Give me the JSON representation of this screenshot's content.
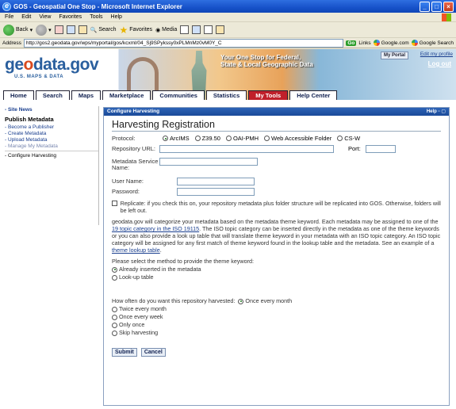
{
  "window": {
    "title": "GOS - Geospatial One Stop - Microsoft Internet Explorer"
  },
  "menu": [
    "File",
    "Edit",
    "View",
    "Favorites",
    "Tools",
    "Help"
  ],
  "toolbar": {
    "back": "Back",
    "search": "Search",
    "favorites": "Favorites",
    "media": "Media"
  },
  "address": {
    "label": "Address",
    "url": "http://gos2.geodata.gov/wps/myportal/gos/kcxml/04_Sj9SPykssy0xPLMnMz0vM0Y_C",
    "go": "Go",
    "links": "Links",
    "google1": "Google.com",
    "google2": "Google Search"
  },
  "banner": {
    "logo_a": "ge",
    "logo_dot": "o",
    "logo_b": "data.gov",
    "logo_sub": "U.S. MAPS & DATA",
    "tagline_1": "Your One Stop for Federal,",
    "tagline_2": "State & Local Geographic Data",
    "portal": "My Portal",
    "edit_profile": "Edit my profile",
    "logout": "Log out"
  },
  "nav_tabs": [
    "Home",
    "Search",
    "Maps",
    "Marketplace",
    "Communities",
    "Statistics",
    "My Tools",
    "Help Center"
  ],
  "sidebar": {
    "site_news": "- Site News",
    "heading": "Publish Metadata",
    "links": [
      "Become a Publisher",
      "Create Metadata",
      "Upload Metadata"
    ],
    "manage": "Manage My Metadata",
    "current": "Configure Harvesting"
  },
  "panel": {
    "header": "Configure Harvesting",
    "help": "Help",
    "title": "Harvesting Registration",
    "protocol_label": "Protocol:",
    "protocols": [
      "ArcIMS",
      "Z39.50",
      "OAI-PMH",
      "Web Accessible Folder",
      "CS-W"
    ],
    "repo_label": "Repository URL:",
    "port_label": "Port:",
    "service_label": "Metadata Service Name:",
    "user_label": "User Name:",
    "password_label": "Password:",
    "replicate": "Replicate: if you check this on, your repository metadata plus folder structure will be replicated into GOS. Otherwise, folders will be left out.",
    "para_1": "geodata.gov will categorize your metadata based on the metadata theme keyword. Each metadata may be assigned to one of the",
    "para_link": "19 topic category in the ISO 19115",
    "para_2": ". The ISO topic category can be inserted directly in the metadata as one of the theme keywords or you can also provide a look up table that will translate theme keyword in your metadata with an ISO topic category. An ISO topic category will be assigned for any first match of theme keyword found in the lookup table and the metadata. See an example of a",
    "para_link2": "theme lookup table",
    "para_end": ".",
    "method_prompt": "Please select the method to provide the theme keyword:",
    "methods": [
      "Already inserted in the metadata",
      "Look-up table"
    ],
    "freq_prompt": "How often do you want this repository harvested:",
    "freq_first": "Once every month",
    "freqs": [
      "Twice every month",
      "Once every week",
      "Only once",
      "Skip harvesting"
    ],
    "submit": "Submit",
    "cancel": "Cancel"
  }
}
